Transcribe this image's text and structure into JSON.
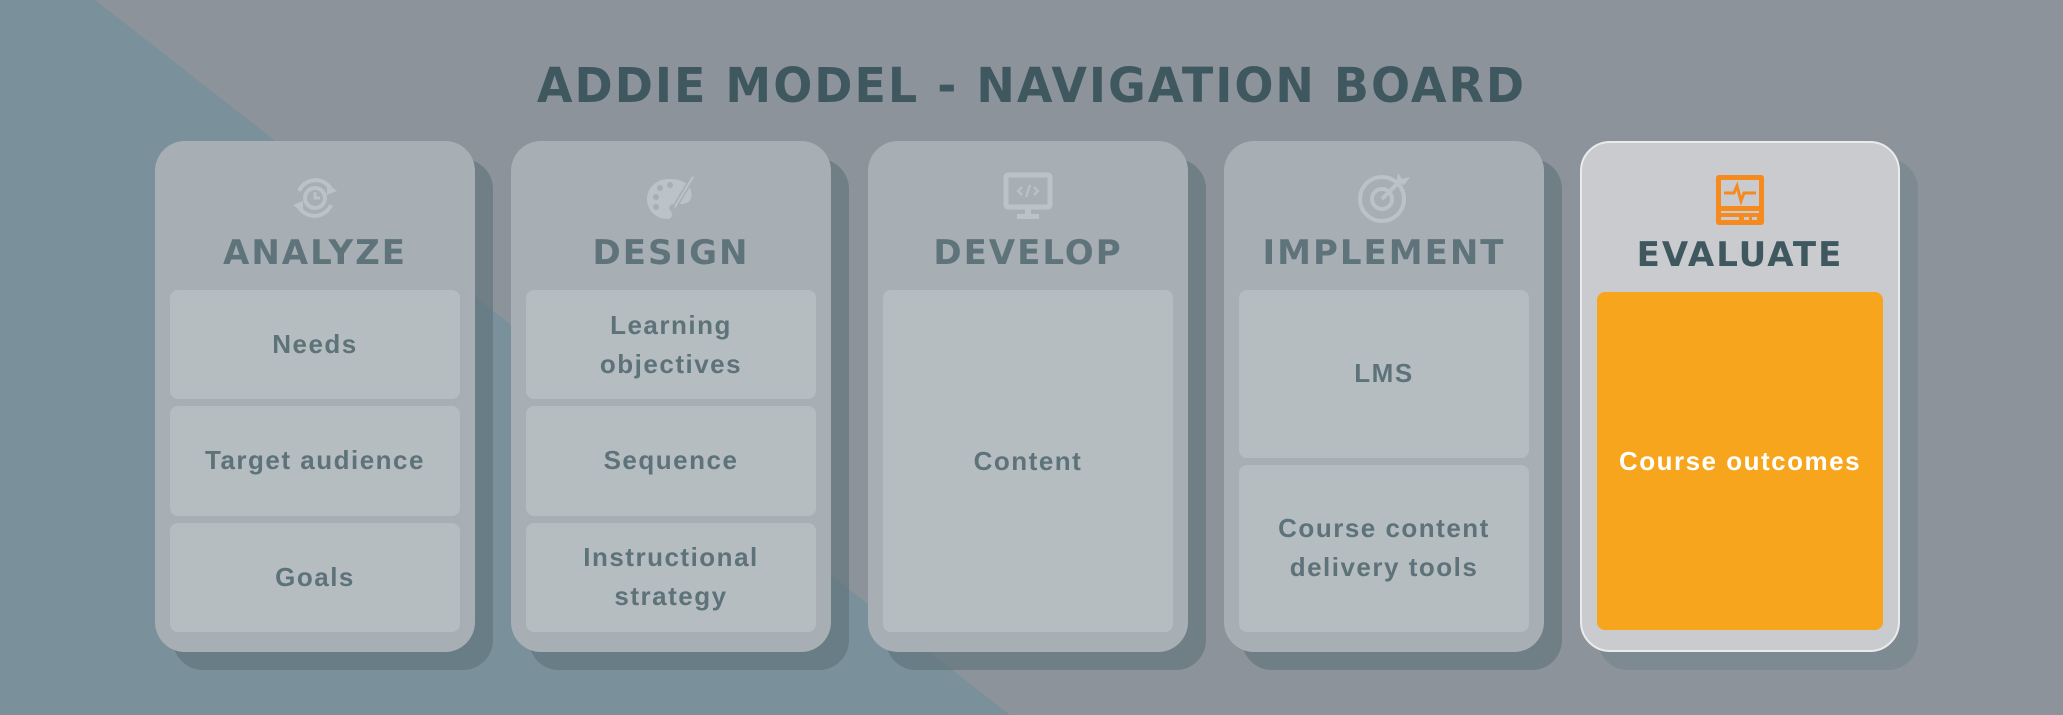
{
  "title": "ADDIE MODEL - NAVIGATION BOARD",
  "colors": {
    "background": "#8c939a",
    "background_accent": "#7a909a",
    "title": "#3f5860",
    "card": "#a8afb4",
    "card_active": "#c9cbce",
    "item": "#b5bdc0",
    "item_text": "#5e727a",
    "accent": "#f7a51c",
    "accent_icon": "#f58a1f"
  },
  "phases": [
    {
      "name": "ANALYZE",
      "icon": "cycle-clock-icon",
      "active": false,
      "items": [
        {
          "label": "Needs"
        },
        {
          "label": "Target audience"
        },
        {
          "label": "Goals"
        }
      ]
    },
    {
      "name": "DESIGN",
      "icon": "palette-icon",
      "active": false,
      "items": [
        {
          "label": "Learning objectives"
        },
        {
          "label": "Sequence"
        },
        {
          "label": "Instructional strategy"
        }
      ]
    },
    {
      "name": "DEVELOP",
      "icon": "code-monitor-icon",
      "active": false,
      "items": [
        {
          "label": "Content"
        }
      ]
    },
    {
      "name": "IMPLEMENT",
      "icon": "target-icon",
      "active": false,
      "items": [
        {
          "label": "LMS"
        },
        {
          "label": "Course content delivery tools"
        }
      ]
    },
    {
      "name": "EVALUATE",
      "icon": "heartbeat-monitor-icon",
      "active": true,
      "items": [
        {
          "label": "Course outcomes",
          "active": true
        }
      ]
    }
  ]
}
